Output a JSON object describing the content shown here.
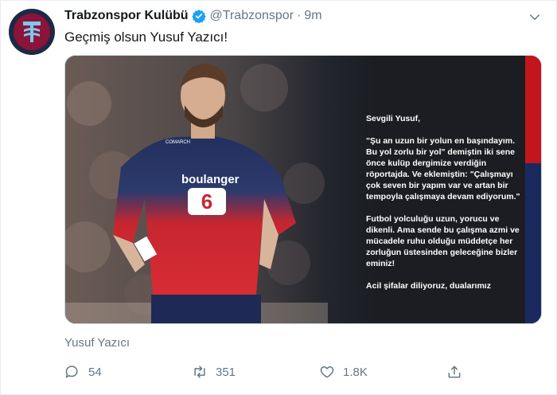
{
  "tweet": {
    "display_name": "Trabzonspor Kulübü",
    "handle": "@Trabzonspor",
    "separator": "·",
    "time": "9m",
    "text": "Geçmiş olsun Yusuf Yazıcı!",
    "media_caption": "Yusuf Yazıcı"
  },
  "letter": {
    "greeting": "Sevgili Yusuf,",
    "p1": "\"Şu an uzun bir yolun en başındayım. Bu yol zorlu bir yol\" demiştin iki sene önce kulüp dergimize verdiğin röportajda. Ve eklemiştin: \"Çalışmayı çok seven bir yapım var ve artan bir tempoyla çalışmaya devam ediyorum.\"",
    "p2": "Futbol yolculuğu uzun, yorucu ve dikenli. Ama sende bu çalışma azmi ve mücadele ruhu olduğu müddetçe her zorluğun üstesinden geleceğine bizler eminiz!",
    "p3": "Acil şifalar diliyoruz, dualarımız"
  },
  "jersey": {
    "sponsor": "boulanger",
    "badge": "COMARCH"
  },
  "actions": {
    "replies": "54",
    "retweets": "351",
    "likes": "1.8K"
  },
  "colors": {
    "accent_blue": "#1da1f2",
    "muted": "#657786",
    "club_maroon": "#8a1538",
    "club_blue": "#1e2a44",
    "lille_red": "#c3161c",
    "lille_navy": "#1a2a5e"
  },
  "icons": [
    "verified-icon",
    "chevron-down-icon",
    "reply-icon",
    "retweet-icon",
    "like-icon",
    "share-icon"
  ]
}
